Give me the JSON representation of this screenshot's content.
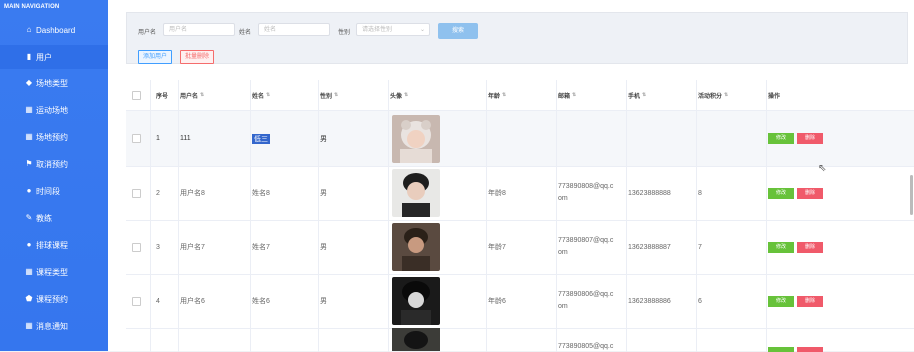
{
  "sidebar": {
    "title": "MAIN NAVIGATION",
    "items": [
      {
        "icon": "home-icon",
        "glyph": "⌂",
        "label": "Dashboard"
      },
      {
        "icon": "bar-chart-icon",
        "glyph": "▮",
        "label": "用户"
      },
      {
        "icon": "car-icon",
        "glyph": "◆",
        "label": "场地类型"
      },
      {
        "icon": "grid-icon",
        "glyph": "▦",
        "label": "运动场地"
      },
      {
        "icon": "grid-icon",
        "glyph": "▦",
        "label": "场地预约"
      },
      {
        "icon": "flag-icon",
        "glyph": "⚑",
        "label": "取消预约"
      },
      {
        "icon": "map-pin-icon",
        "glyph": "●",
        "label": "时间段"
      },
      {
        "icon": "tag-icon",
        "glyph": "✎",
        "label": "教练"
      },
      {
        "icon": "user-icon",
        "glyph": "●",
        "label": "排球课程"
      },
      {
        "icon": "grid-icon",
        "glyph": "▦",
        "label": "课程类型"
      },
      {
        "icon": "shield-icon",
        "glyph": "⬟",
        "label": "课程预约"
      },
      {
        "icon": "grid-icon",
        "glyph": "▦",
        "label": "消息通知"
      }
    ]
  },
  "search": {
    "username_label": "用户名",
    "username_placeholder": "用户名",
    "name_label": "姓名",
    "name_placeholder": "姓名",
    "gender_label": "性别",
    "gender_placeholder": "请选择性别",
    "search_button": "搜索"
  },
  "actions": {
    "add": "添加用户",
    "batch_delete": "批量删除"
  },
  "table": {
    "headers": [
      "序号",
      "用户名",
      "姓名",
      "性别",
      "头像",
      "年龄",
      "邮箱",
      "手机",
      "活动积分",
      "操作"
    ],
    "edit_label": "修改",
    "delete_label": "删除",
    "rows": [
      {
        "no": "1",
        "username": "111",
        "name": "低三",
        "gender": "男",
        "age": "",
        "email": [
          "",
          ""
        ],
        "phone": "",
        "points": ""
      },
      {
        "no": "2",
        "username": "用户名8",
        "name": "姓名8",
        "gender": "男",
        "age": "年龄8",
        "email": [
          "773890808@qq.c",
          "om"
        ],
        "phone": "13623888888",
        "points": "8"
      },
      {
        "no": "3",
        "username": "用户名7",
        "name": "姓名7",
        "gender": "男",
        "age": "年龄7",
        "email": [
          "773890807@qq.c",
          "om"
        ],
        "phone": "13623888887",
        "points": "7"
      },
      {
        "no": "4",
        "username": "用户名6",
        "name": "姓名6",
        "gender": "男",
        "age": "年龄6",
        "email": [
          "773890806@qq.c",
          "om"
        ],
        "phone": "13623888886",
        "points": "6"
      },
      {
        "no": "",
        "username": "",
        "name": "",
        "gender": "",
        "age": "",
        "email": [
          "773890805@qq.c",
          ""
        ],
        "phone": "",
        "points": ""
      }
    ]
  },
  "colors": {
    "sidebar": "#3a7bf0",
    "edit": "#67c23a",
    "delete": "#f05a6a",
    "search": "#8fc1ee"
  }
}
